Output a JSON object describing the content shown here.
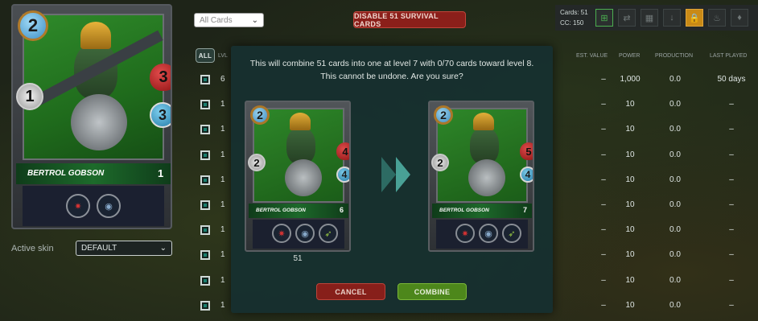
{
  "big_card": {
    "name": "BERTROL GOBSON",
    "level": "1",
    "mana": "2",
    "attack": "1",
    "health": "3",
    "armor": "3",
    "abilities": [
      "blast-ability-icon",
      "sneak-ability-icon"
    ]
  },
  "skin": {
    "label": "Active skin",
    "value": "DEFAULT"
  },
  "filter": {
    "value": "All Cards"
  },
  "disable_button": "DISABLE 51 SURVIVAL CARDS",
  "stats": {
    "cards_label": "Cards:",
    "cards_value": "51",
    "cc_label": "CC:",
    "cc_value": "150"
  },
  "toolbar_icons": [
    "add-card-icon",
    "transfer-icon",
    "rent-icon",
    "download-icon",
    "lock-icon",
    "burn-icon",
    "fire-icon"
  ],
  "table": {
    "all_tab": "ALL",
    "lvl_header": "LVL",
    "headers": [
      "EST. VALUE",
      "POWER",
      "PRODUCTION",
      "LAST PLAYED"
    ],
    "rows": [
      {
        "lvl": "6",
        "value": "–",
        "power": "1,000",
        "production": "0.0",
        "last": "50 days"
      },
      {
        "lvl": "1",
        "value": "–",
        "power": "10",
        "production": "0.0",
        "last": "–"
      },
      {
        "lvl": "1",
        "value": "–",
        "power": "10",
        "production": "0.0",
        "last": "–"
      },
      {
        "lvl": "1",
        "value": "–",
        "power": "10",
        "production": "0.0",
        "last": "–"
      },
      {
        "lvl": "1",
        "value": "–",
        "power": "10",
        "production": "0.0",
        "last": "–"
      },
      {
        "lvl": "1",
        "value": "–",
        "power": "10",
        "production": "0.0",
        "last": "–"
      },
      {
        "lvl": "1",
        "value": "–",
        "power": "10",
        "production": "0.0",
        "last": "–"
      },
      {
        "lvl": "1",
        "value": "–",
        "power": "10",
        "production": "0.0",
        "last": "–"
      },
      {
        "lvl": "1",
        "value": "–",
        "power": "10",
        "production": "0.0",
        "last": "–"
      },
      {
        "lvl": "1",
        "value": "–",
        "power": "10",
        "production": "0.0",
        "last": "–"
      }
    ]
  },
  "modal": {
    "message_line1": "This will combine 51 cards into one at level 7 with 0/70 cards toward level 8.",
    "message_line2": "This cannot be undone. Are you sure?",
    "from_card": {
      "name": "BERTROL GOBSON",
      "level": "6",
      "mana": "2",
      "attack": "2",
      "health": "4",
      "armor": "4",
      "count": "51"
    },
    "to_card": {
      "name": "BERTROL GOBSON",
      "level": "7",
      "mana": "2",
      "attack": "2",
      "health": "5",
      "armor": "4"
    },
    "cancel_label": "CANCEL",
    "combine_label": "COMBINE"
  },
  "colors": {
    "accent_red": "#8b1f1a",
    "accent_green": "#4f8a1c",
    "panel": "#17302f"
  }
}
